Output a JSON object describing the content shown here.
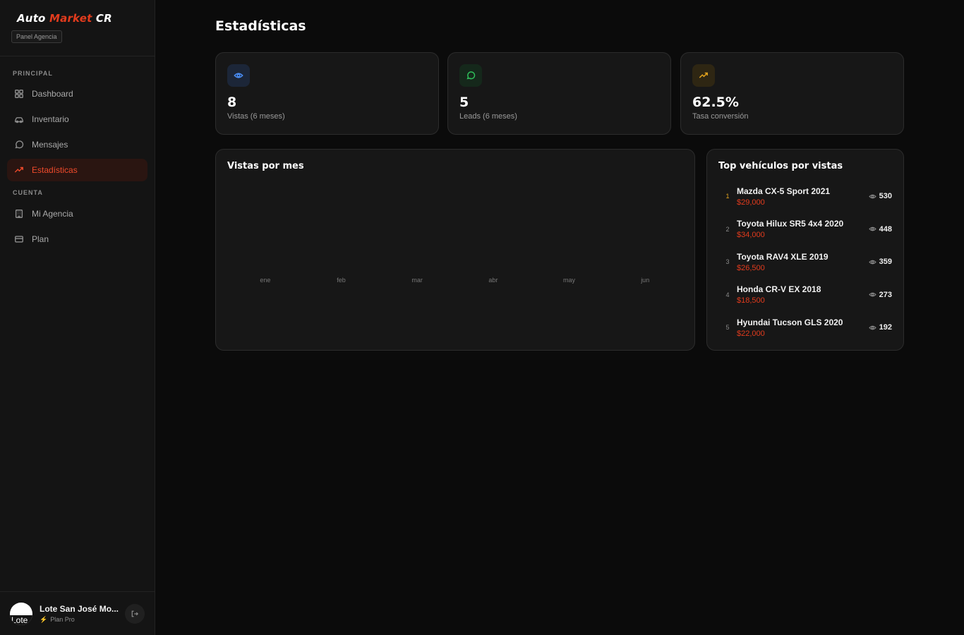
{
  "brand": {
    "word1": "Auto",
    "word2": "Market",
    "word3": "CR",
    "badge": "Panel Agencia",
    "accent": "#e23b1d"
  },
  "nav": {
    "principal_heading": "PRINCIPAL",
    "principal_items": [
      {
        "label": "Dashboard",
        "icon": "grid-icon"
      },
      {
        "label": "Inventario",
        "icon": "car-icon"
      },
      {
        "label": "Mensajes",
        "icon": "message-icon"
      },
      {
        "label": "Estadísticas",
        "icon": "trending-up-icon",
        "active": true
      }
    ],
    "cuenta_heading": "CUENTA",
    "cuenta_items": [
      {
        "label": "Mi Agencia",
        "icon": "building-icon"
      },
      {
        "label": "Plan",
        "icon": "card-icon"
      }
    ]
  },
  "user": {
    "name": "Lote San José Mo...",
    "plan": "Plan Pro",
    "avatar_alt": "Lote"
  },
  "page": {
    "title": "Estadísticas"
  },
  "stats": [
    {
      "value": "8",
      "label": "Vistas (6 meses)",
      "icon": "eye-icon",
      "color": "#4a8df5"
    },
    {
      "value": "5",
      "label": "Leads (6 meses)",
      "icon": "message-icon",
      "color": "#2fbf5a"
    },
    {
      "value": "62.5%",
      "label": "Tasa conversión",
      "icon": "trending-up-icon",
      "color": "#e2a21d"
    }
  ],
  "chart": {
    "title": "Vistas por mes",
    "months": [
      "ene",
      "feb",
      "mar",
      "abr",
      "may",
      "jun"
    ]
  },
  "top_vehicles": {
    "title": "Top vehículos por vistas",
    "items": [
      {
        "rank": "1",
        "name": "Mazda CX-5 Sport 2021",
        "price": "$29,000",
        "views": "530"
      },
      {
        "rank": "2",
        "name": "Toyota Hilux SR5 4x4 2020",
        "price": "$34,000",
        "views": "448"
      },
      {
        "rank": "3",
        "name": "Toyota RAV4 XLE 2019",
        "price": "$26,500",
        "views": "359"
      },
      {
        "rank": "4",
        "name": "Honda CR-V EX 2018",
        "price": "$18,500",
        "views": "273"
      },
      {
        "rank": "5",
        "name": "Hyundai Tucson GLS 2020",
        "price": "$22,000",
        "views": "192"
      }
    ]
  }
}
